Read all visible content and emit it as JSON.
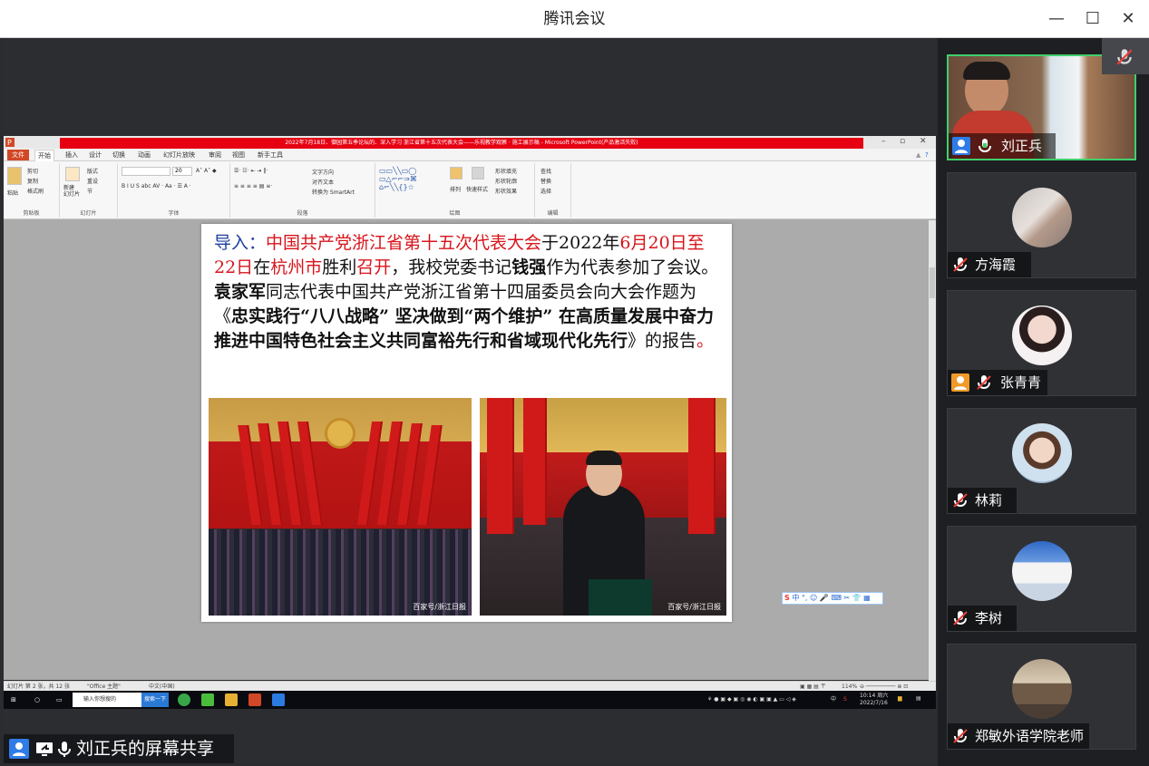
{
  "window": {
    "title": "腾讯会议",
    "minimize_glyph": "—",
    "maximize_glyph": "☐",
    "close_glyph": "✕"
  },
  "ppt": {
    "title": "2022年7月18日、御园第五季论坛的、深入学习 浙江省第十五次代表大会——乐视教学观察 · 施工展示稿 - Microsoft PowerPoint(产品激活失败)",
    "tabs": [
      "文件",
      "开始",
      "插入",
      "设计",
      "切换",
      "动画",
      "幻灯片放映",
      "审阅",
      "视图",
      "新手工具"
    ],
    "ribbon_groups": [
      "剪贴板",
      "幻灯片",
      "字体",
      "段落",
      "绘图",
      "编辑"
    ],
    "ribbon_items": {
      "paste": "粘贴",
      "cut": "剪切",
      "copy": "复制",
      "format_painter": "格式刷",
      "new_slide": "新建\n幻灯片",
      "layout": "版式",
      "reset": "重设",
      "section": "节",
      "text_direction": "文字方向",
      "align_text": "对齐文本",
      "smartart": "转换为 SmartArt",
      "arrange": "排列",
      "quick_styles": "快速样式",
      "shape_fill": "形状填充",
      "shape_outline": "形状轮廓",
      "shape_effects": "形状效果",
      "find": "查找",
      "replace": "替换",
      "select": "选择"
    },
    "font_size": "20",
    "status": {
      "slide_info": "幻灯片 第 2 张，共 12 张",
      "theme": "\"Office 主题\"",
      "language": "中文(中国)",
      "zoom": "114%"
    }
  },
  "slide": {
    "intro_label": "导入：",
    "segments": [
      {
        "text": "中国共产党浙江省第十五次代表大会",
        "cls": "red"
      },
      {
        "text": "于2022年",
        "cls": "black"
      },
      {
        "text": "6月20日至22日",
        "cls": "red"
      },
      {
        "text": "在",
        "cls": "black"
      },
      {
        "text": "杭州市",
        "cls": "red"
      },
      {
        "text": "胜利",
        "cls": "black"
      },
      {
        "text": "召开",
        "cls": "red"
      },
      {
        "text": "，我校党委书记",
        "cls": "black"
      },
      {
        "text": "钱强",
        "cls": "black bold"
      },
      {
        "text": "作为代表参加了会议。",
        "cls": "black"
      },
      {
        "text": "袁家军",
        "cls": "black bold"
      },
      {
        "text": "同志代表中国共产党浙江省第十四届委员会向大会作题为《",
        "cls": "black"
      },
      {
        "text": "忠实践行“八八战略” 坚决做到“两个维护”  在高质量发展中奋力推进中国特色社会主义共同富裕先行和省域现代化先行",
        "cls": "black bold"
      },
      {
        "text": "》的报告",
        "cls": "black"
      },
      {
        "text": "。",
        "cls": "red"
      }
    ],
    "photo_left_caption": "百家号/浙江日报",
    "photo_right_caption": "百家号/浙江日报"
  },
  "ime": {
    "logo": "S",
    "text": "中 °, ☺ 🎤 ⌨ ✂ 👕 ▦"
  },
  "taskbar": {
    "search_placeholder": "输入你想搜的",
    "search_button": "搜索一下",
    "tray_text": "中",
    "clock_time": "10:14 周六",
    "clock_date": "2022/7/16"
  },
  "share_label": "刘正兵的屏幕共享",
  "participants": [
    {
      "name": "刘正兵",
      "mic": "on",
      "host": true,
      "active": true
    },
    {
      "name": "方海霞",
      "mic": "muted",
      "host": false
    },
    {
      "name": "张青青",
      "mic": "muted",
      "host": true
    },
    {
      "name": "林莉",
      "mic": "muted",
      "host": false
    },
    {
      "name": "李树",
      "mic": "muted",
      "host": false
    },
    {
      "name": "郑敏外语学院老师",
      "mic": "muted",
      "host": false
    }
  ],
  "colors": {
    "accent_green": "#3fcf6c",
    "host_blue": "#2f7ce8",
    "host_orange": "#f09a2a",
    "ppt_red": "#e60012"
  }
}
